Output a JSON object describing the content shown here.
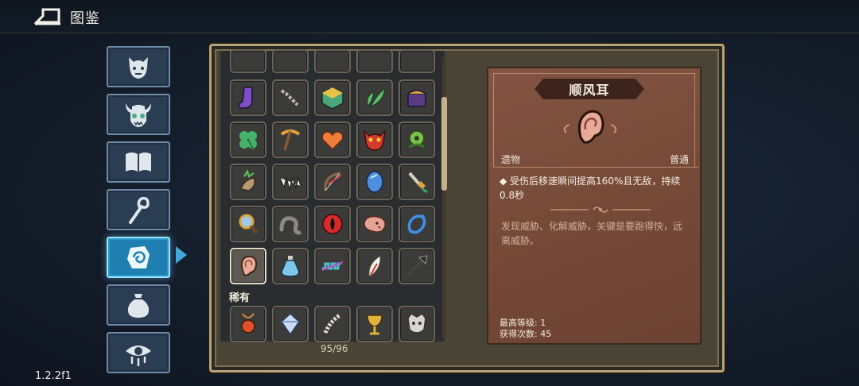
{
  "header": {
    "title": "图鉴",
    "back_icon": "back-arrow-icon"
  },
  "version": "1.2.2f1",
  "tabs": [
    {
      "name": "monster",
      "icon": "imp-face-icon",
      "active": false
    },
    {
      "name": "boss",
      "icon": "horned-skull-icon",
      "active": false
    },
    {
      "name": "book",
      "icon": "open-book-icon",
      "active": false
    },
    {
      "name": "staff",
      "icon": "staff-icon",
      "active": false
    },
    {
      "name": "relic",
      "icon": "relic-hand-icon",
      "active": true
    },
    {
      "name": "bag",
      "icon": "sack-icon",
      "active": false
    },
    {
      "name": "eye",
      "icon": "dripping-eye-icon",
      "active": false
    }
  ],
  "grid": {
    "rare_section_label": "稀有",
    "count_text": "95/96",
    "items": [
      "partial-top-1",
      "partial-top-2",
      "partial-top-3",
      "partial-top-4",
      "partial-top-5",
      "purple-sock-icon",
      "bone-chain-icon",
      "green-dice-icon",
      "green-leaves-icon",
      "treasure-chest-icon",
      "four-leaf-clover-icon",
      "pickaxe-icon",
      "orange-heart-icon",
      "red-demon-mask-icon",
      "green-plant-monster-icon",
      "mandrake-root-icon",
      "fang-teeth-icon",
      "bow-icon",
      "blue-crystal-icon",
      "golden-dagger-icon",
      "magnifying-glass-icon",
      "grey-worm-icon",
      "red-eye-icon",
      "pink-blob-icon",
      "blue-swirl-icon",
      "ear-icon",
      "blue-potion-icon",
      "rainbow-coil-icon",
      "white-feather-icon",
      "black-spear-icon",
      "red-amulet-icon",
      "blue-gem-icon",
      "bone-spine-icon",
      "golden-chalice-icon",
      "grey-mask-icon"
    ]
  },
  "detail": {
    "name": "顺风耳",
    "icon": "ear-icon",
    "category": "遗物",
    "rarity": "普通",
    "effect": "◆ 受伤后移速瞬间提高160%且无敌，持续0.8秒",
    "flavor": "发现威胁、化解威胁，关键是要跑得快，远离威胁。",
    "max_level_label": "最高等级: 1",
    "obtained_label": "获得次数: 45"
  },
  "colors": {
    "panel": "#7a4d3a",
    "active_tab": "#1f7fb0",
    "frame_gold": "#b9a27a"
  }
}
